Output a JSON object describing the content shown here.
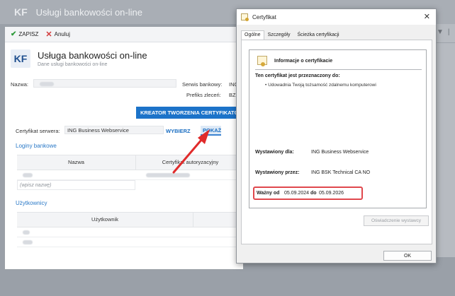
{
  "background": {
    "logo": "KF",
    "title": "Usługi bankowości on-line"
  },
  "toolbar": {
    "save_label": "ZAPISZ",
    "cancel_label": "Anuluj"
  },
  "form": {
    "logo": "KF",
    "title": "Usługa bankowości on-line",
    "subtitle": "Dane usługi bankowości on-line",
    "name_label": "Nazwa:",
    "bank_service_label": "Serwis bankowy:",
    "bank_service_value": "ING",
    "prefix_label": "Prefiks zleceń:",
    "prefix_value": "BZ",
    "creator_button": "KREATOR TWORZENIA CERTYFIKATÓW",
    "server_cert_label": "Certyfikat serwera:",
    "server_cert_value": "ING Business Webservice",
    "choose_button": "WYBIERZ",
    "show_button": "POKAŻ",
    "logins_section": "Loginy bankowe",
    "logins_columns": [
      "Nazwa",
      "Certyfikat autoryzacyjny"
    ],
    "logins_placeholder": "(wpisz nazwę)",
    "users_section": "Użytkownicy",
    "users_columns": [
      "Użytkownik"
    ]
  },
  "cert": {
    "title": "Certyfikat",
    "tabs": [
      "Ogólne",
      "Szczegóły",
      "Ścieżka certyfikacji"
    ],
    "info_header": "Informacje o certyfikacie",
    "purpose_title": "Ten certyfikat jest przeznaczony do:",
    "purpose_item": "• Udowadnia Twoją tożsamość zdalnemu komputerowi",
    "issued_to_label": "Wystawiony dla:",
    "issued_to_value": "ING Business Webservice",
    "issued_by_label": "Wystawiony przez:",
    "issued_by_value": "ING BSK Technical CA NO",
    "valid_from_label": "Ważny od",
    "valid_from_value": "05.09.2024",
    "valid_to_label": "do",
    "valid_to_value": "05.09.2026",
    "issuer_statement_button": "Oświadczenie wystawcy",
    "ok_button": "OK"
  },
  "colors": {
    "accent": "#1c73c9",
    "highlight": "#e0484d"
  }
}
